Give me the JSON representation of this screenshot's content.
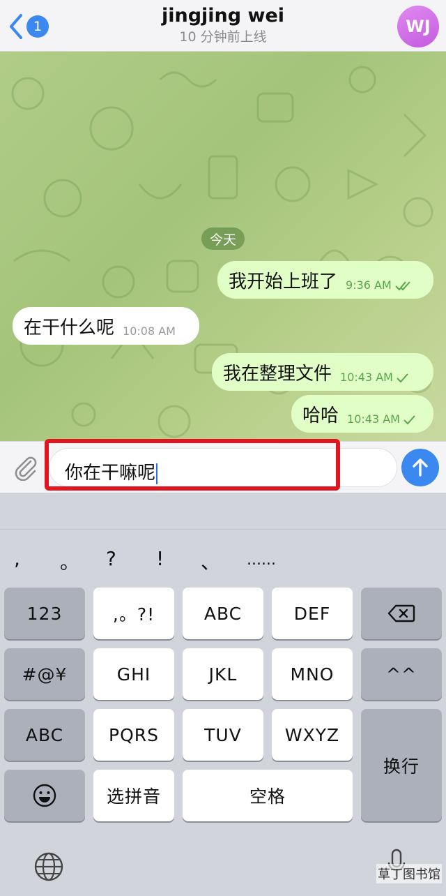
{
  "header": {
    "back_badge": "1",
    "title": "jingjing wei",
    "subtitle": "10 分钟前上线",
    "avatar_initials": "WJ"
  },
  "chat": {
    "date_label": "今天",
    "messages": [
      {
        "direction": "out",
        "text": "我开始上班了",
        "time": "9:36 AM",
        "status": "read"
      },
      {
        "direction": "in",
        "text": "在干什么呢",
        "time": "10:08 AM"
      },
      {
        "direction": "out",
        "text": "我在整理文件",
        "time": "10:43 AM",
        "status": "sent"
      },
      {
        "direction": "out",
        "text": "哈哈",
        "time": "10:43 AM",
        "status": "sent"
      }
    ]
  },
  "composer": {
    "value": "你在干嘛呢"
  },
  "keyboard": {
    "punctuation": [
      ",",
      "。",
      "?",
      "!",
      "、",
      "......"
    ],
    "rows": [
      [
        "123",
        ",。?!",
        "ABC",
        "DEF",
        "delete"
      ],
      [
        "#@¥",
        "GHI",
        "JKL",
        "MNO",
        "^^"
      ],
      [
        "ABC",
        "PQRS",
        "TUV",
        "WXYZ",
        "换行"
      ],
      [
        "emoji",
        "选拼音",
        "空格"
      ]
    ],
    "labels": {
      "k123": "123",
      "punct_key": ",。?!",
      "abc": "ABC",
      "def": "DEF",
      "symbols": "#@¥",
      "ghi": "GHI",
      "jkl": "JKL",
      "mno": "MNO",
      "kaomoji": "^^",
      "abc2": "ABC",
      "pqrs": "PQRS",
      "tuv": "TUV",
      "wxyz": "WXYZ",
      "return": "换行",
      "pinyin": "选拼音",
      "space": "空格"
    }
  },
  "watermark": "草丁图书馆",
  "colors": {
    "accent": "#3b88f0",
    "outgoing_bubble": "#e1fec6",
    "incoming_bubble": "#ffffff",
    "read_check": "#58a64b",
    "highlight_box": "#e0161e",
    "chat_background": "#a4c47a"
  }
}
